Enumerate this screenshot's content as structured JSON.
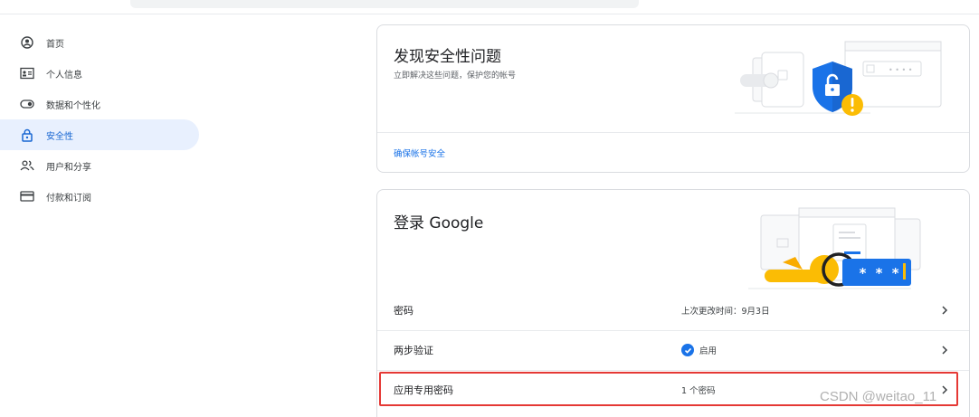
{
  "sidebar": {
    "items": [
      {
        "label": "首页",
        "icon": "home-circle-icon",
        "active": false
      },
      {
        "label": "个人信息",
        "icon": "id-card-icon",
        "active": false
      },
      {
        "label": "数据和个性化",
        "icon": "toggle-icon",
        "active": false
      },
      {
        "label": "安全性",
        "icon": "lock-icon",
        "active": true
      },
      {
        "label": "用户和分享",
        "icon": "people-icon",
        "active": false
      },
      {
        "label": "付款和订阅",
        "icon": "credit-card-icon",
        "active": false
      }
    ]
  },
  "security_issues": {
    "title": "发现安全性问题",
    "subtitle": "立即解决这些问题，保护您的帐号",
    "link": "确保帐号安全"
  },
  "signin": {
    "title": "登录 Google",
    "rows": [
      {
        "label": "密码",
        "value": "上次更改时间：9月3日",
        "check": false
      },
      {
        "label": "两步验证",
        "value": "启用",
        "check": true
      },
      {
        "label": "应用专用密码",
        "value": "1 个密码",
        "check": false
      }
    ],
    "password_mask": "* * *"
  },
  "watermark": "CSDN @weitao_11",
  "colors": {
    "accent": "#1a73e8",
    "active_bg": "#e8f0fe",
    "warning": "#fbbc04",
    "highlight": "#e53935"
  }
}
